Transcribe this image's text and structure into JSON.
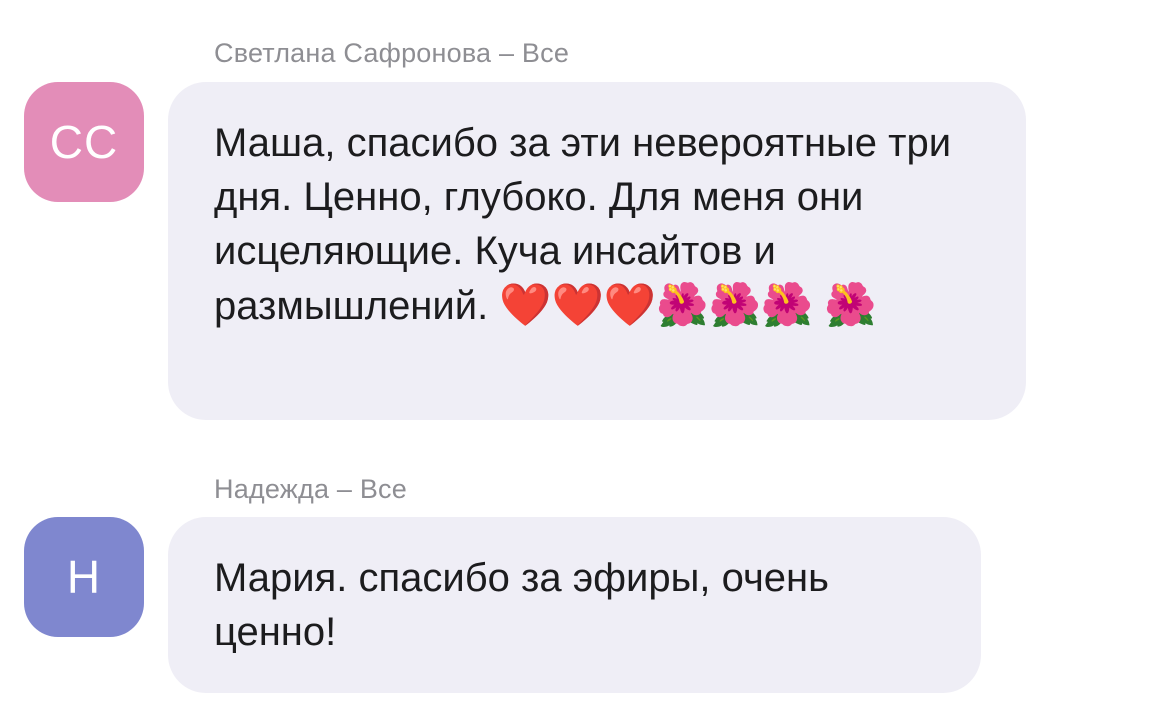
{
  "messages": [
    {
      "sender": "Светлана Сафронова",
      "separator": "–",
      "audience": "Все",
      "initials": "СС",
      "avatar_color": "#e38db8",
      "text": "Маша, спасибо за эти невероятные три дня. Ценно, глубоко. Для меня они исцеляющие. Куча инсайтов и размышлений.",
      "emoji_line_1": "❤️❤️❤️🌺🌺🌺",
      "emoji_line_2": "🌺"
    },
    {
      "sender": "Надежда",
      "separator": "–",
      "audience": "Все",
      "initials": "Н",
      "avatar_color": "#7f87cf",
      "text": "Мария. спасибо за эфиры, очень ценно!"
    }
  ],
  "colors": {
    "bubble_background": "#efeef6",
    "meta_text": "#8e8e93",
    "message_text": "#1c1c1e"
  }
}
